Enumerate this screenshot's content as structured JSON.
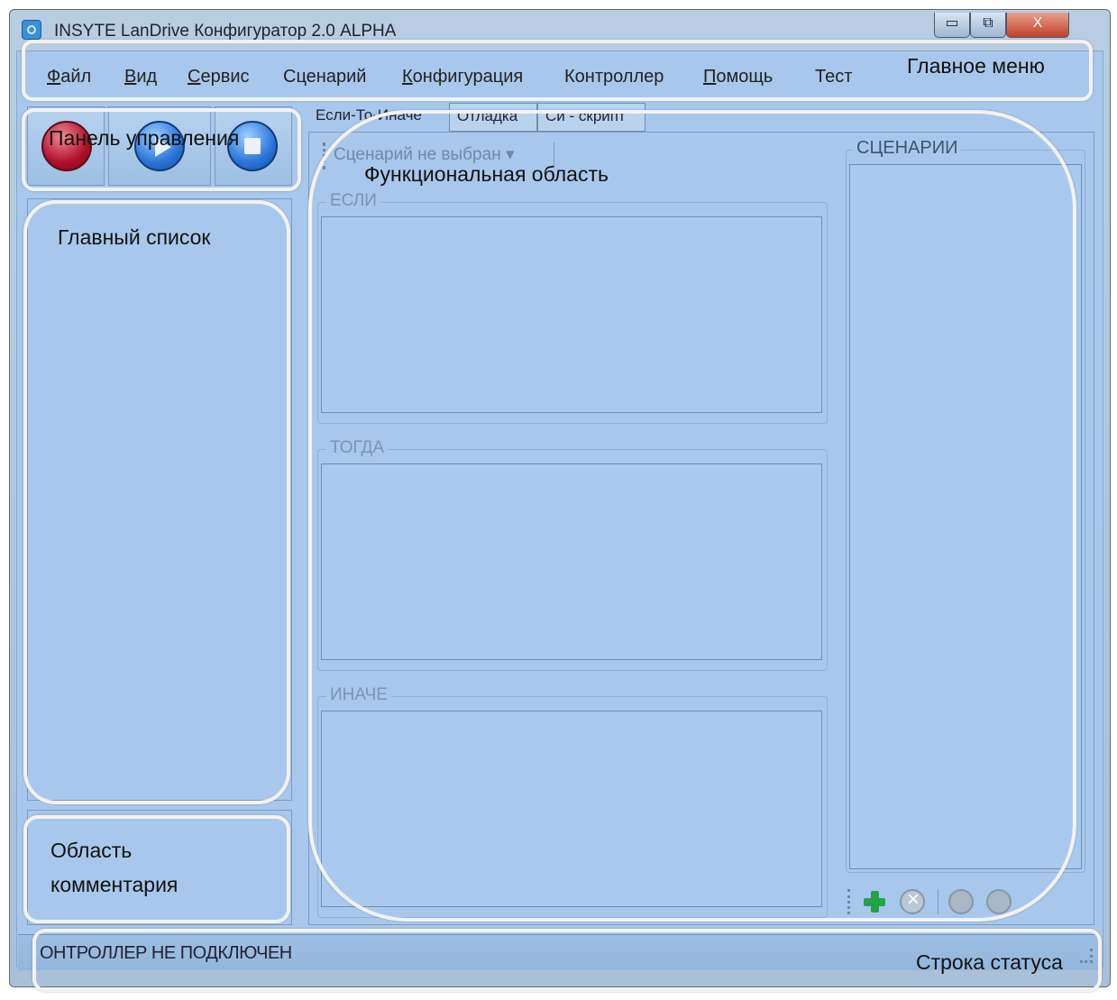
{
  "window": {
    "title": "INSYTE LanDrive Конфигуратор 2.0 ALPHA",
    "minimize_glyph": "▭",
    "maximize_glyph": "⧉",
    "close_glyph": "X"
  },
  "menu": {
    "items": [
      {
        "accel": "Ф",
        "rest": "айл"
      },
      {
        "accel": "В",
        "rest": "ид"
      },
      {
        "accel": "С",
        "rest": "ервис"
      },
      {
        "accel": "",
        "rest": "Сценарий"
      },
      {
        "accel": "К",
        "rest": "онфигурация"
      },
      {
        "accel": "",
        "rest": "Контроллер"
      },
      {
        "accel": "П",
        "rest": "омощь"
      },
      {
        "accel": "",
        "rest": "Тест"
      }
    ]
  },
  "toolbar": {
    "icons": [
      "record-icon",
      "play-icon",
      "stop-icon"
    ]
  },
  "tabs": [
    "Если-То-Иначе",
    "Отладка",
    "Си - скрипт"
  ],
  "editor": {
    "scenario_dropdown": "Сценарий не выбран",
    "dropdown_arrow": "▾",
    "if_label": "ЕСЛИ",
    "then_label": "ТОГДА",
    "else_label": "ИНАЧЕ",
    "scenarios_label": "СЦЕНАРИИ"
  },
  "status": {
    "text": "ОНТРОЛЛЕР НЕ ПОДКЛЮЧЕН"
  },
  "annotations": {
    "main_menu": "Главное меню",
    "control_panel": "Панель управления",
    "main_list": "Главный список",
    "functional_area": "Функциональная область",
    "comment_area_line1": "Область",
    "comment_area_line2": "комментария",
    "status_bar": "Строка статуса"
  }
}
